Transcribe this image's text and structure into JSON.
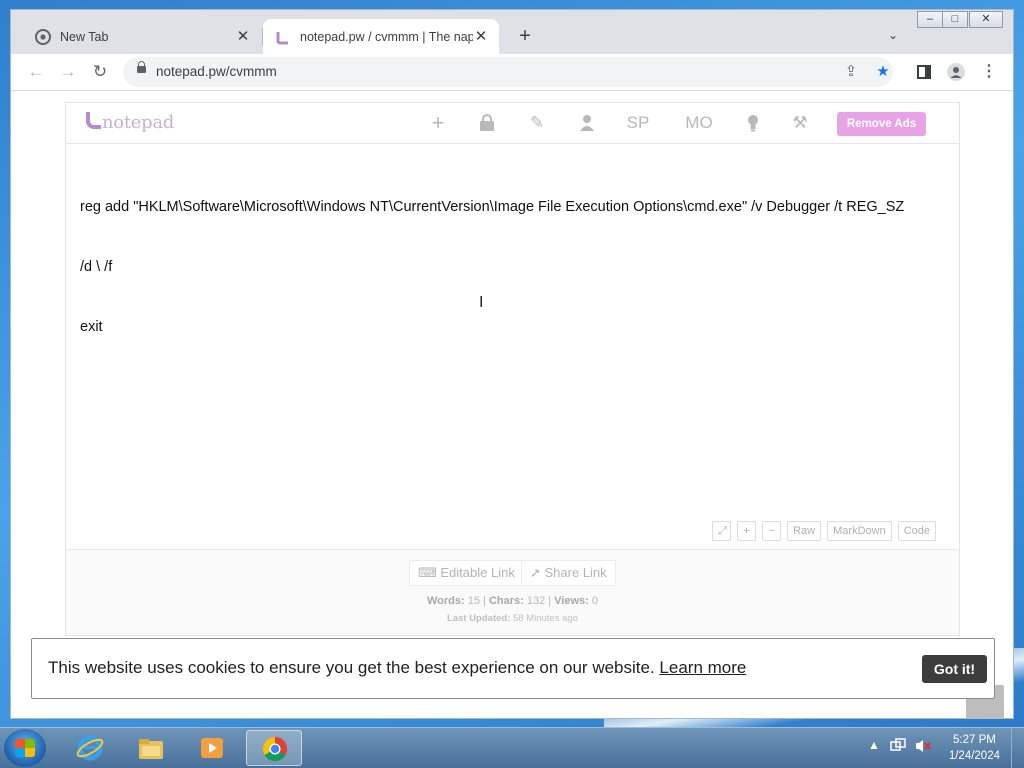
{
  "browser": {
    "tabs": [
      {
        "title": "New Tab",
        "active": false
      },
      {
        "title": "notepad.pw / cvmmm | The napkin",
        "active": true
      }
    ],
    "url": "notepad.pw/cvmmm"
  },
  "notepad": {
    "logo_text": "notepad",
    "header_icons": {
      "sp": "SP",
      "mo": "MO"
    },
    "remove_ads_label": "Remove Ads",
    "content_lines": [
      "reg add \"HKLM\\Software\\Microsoft\\Windows NT\\CurrentVersion\\Image File Execution Options\\cmd.exe\" /v Debugger /t REG_SZ",
      "/d \\ /f",
      "exit"
    ],
    "format_buttons": {
      "raw": "Raw",
      "markdown": "MarkDown",
      "code": "Code"
    },
    "editable_link": "Editable Link",
    "share_link": "Share Link",
    "stats": {
      "words_label": "Words:",
      "words": "15",
      "chars_label": "Chars:",
      "chars": "132",
      "views_label": "Views:",
      "views": "0"
    },
    "last_updated_label": "Last Updated:",
    "last_updated": "58 Minutes ago"
  },
  "cookie": {
    "message": "This website uses cookies to ensure you get the best experience on our website.",
    "learn_more": "Learn more",
    "got_it": "Got it!"
  },
  "taskbar": {
    "time": "5:27 PM",
    "date": "1/24/2024",
    "apps": [
      "internet-explorer",
      "file-explorer",
      "media-player",
      "chrome"
    ]
  },
  "colors": {
    "accent": "#e8a3e6",
    "logo": "#b58bc9",
    "gotit_bg": "#3d3d3d"
  }
}
